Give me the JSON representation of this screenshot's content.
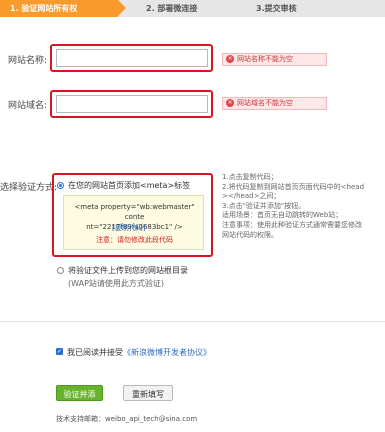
{
  "steps": [
    "1. 验证网站所有权",
    "2. 部署微连接",
    "3.提交审核"
  ],
  "site_name": {
    "label": "网站名称:",
    "value": "",
    "error": "网站名称不能为空"
  },
  "site_domain": {
    "label": "网站域名:",
    "value": "",
    "error": "网站域名不能为空"
  },
  "verify": {
    "label": "选择验证方式:",
    "option_meta": "在您的网站首页添加<meta>标签",
    "meta_line1": "<meta property=\"wb:webmaster\" conte",
    "meta_line2": "nt=\"2217f39fa0683bc1\" />",
    "copy_link": "[复制代码]",
    "warning": "注意：请勿修改此段代码",
    "option_file": "将验证文件上传到您的网站根目录",
    "option_file_note": "(WAP站请使用此方式验证)",
    "tips": [
      "1.点击复制代码；",
      "2.将代码复制到网站首页页面代码中的<head",
      "></head>之间；",
      "3.点击\"验证并添加\"按钮。",
      "适用场景：首页无自动跳转的Web站；",
      "注意事项：使用此种验证方式通常需要您修改",
      "网站代码的权限。"
    ]
  },
  "agreement": {
    "prefix": "我已阅读并接受",
    "link": "《新浪微博开发者协议》"
  },
  "buttons": {
    "submit": "验证并添加",
    "reset": "重新填写"
  },
  "footer": {
    "support": "技术支持邮箱：weibo_api_tech@sina.com"
  },
  "colors": {
    "accent": "#f89b2b",
    "error": "#d9161f",
    "link": "#2a6cc2",
    "submit": "#68b32c"
  }
}
